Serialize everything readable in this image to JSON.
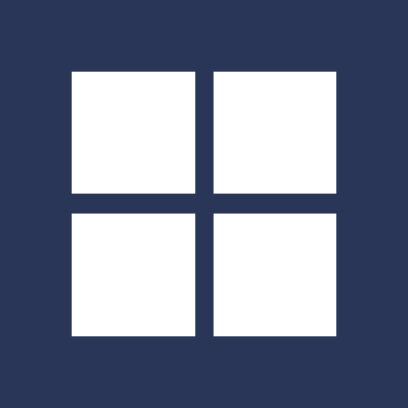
{
  "icon": {
    "name": "grid-icon",
    "background_color": "#2a3658",
    "tile_color": "#ffffff",
    "tile_count": 4
  }
}
